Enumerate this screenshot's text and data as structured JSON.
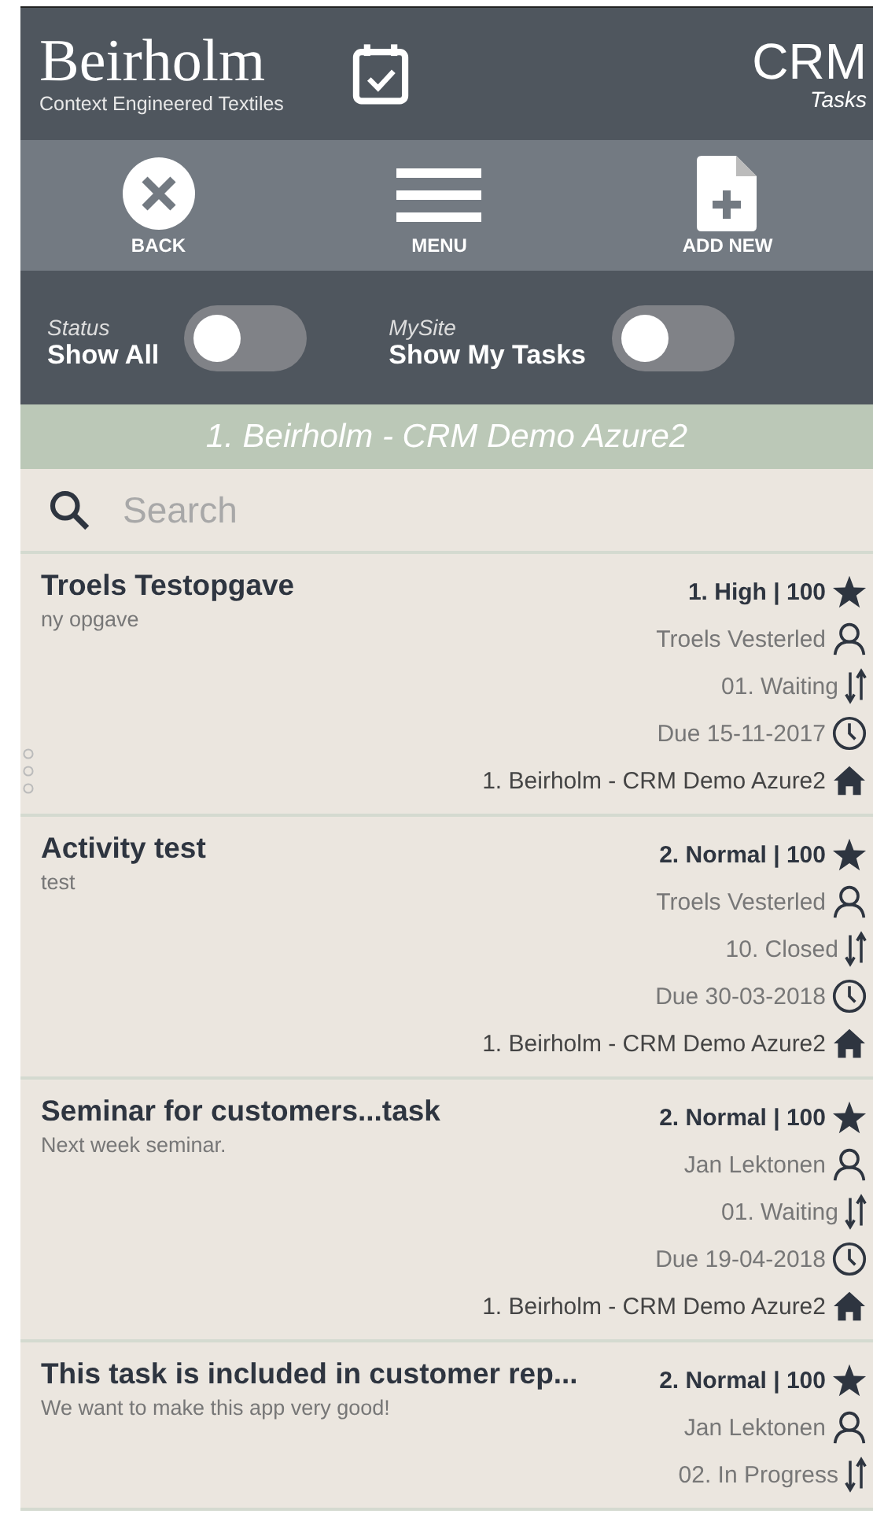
{
  "header": {
    "brand": "Beirholm",
    "tagline": "Context Engineered Textiles",
    "app": "CRM",
    "section": "Tasks"
  },
  "toolbar": [
    {
      "kind": "back",
      "label": "BACK"
    },
    {
      "kind": "menu",
      "label": "MENU"
    },
    {
      "kind": "add",
      "label": "ADD NEW"
    }
  ],
  "filters": [
    {
      "caption": "Status",
      "label": "Show All",
      "on": false
    },
    {
      "caption": "MySite",
      "label": "Show My Tasks",
      "on": false
    }
  ],
  "site_banner": "1. Beirholm - CRM Demo Azure2",
  "search": {
    "placeholder": "Search"
  },
  "tasks": [
    {
      "title": "Troels Testopgave",
      "description": "ny opgave",
      "priority": "1. High | 100",
      "owner": "Troels Vesterled",
      "status": "01. Waiting",
      "due": "Due 15-11-2017",
      "site": "1. Beirholm - CRM Demo Azure2",
      "drag_handle": true
    },
    {
      "title": "Activity test",
      "description": "test",
      "priority": "2. Normal | 100",
      "owner": "Troels Vesterled",
      "status": "10. Closed",
      "due": "Due 30-03-2018",
      "site": "1. Beirholm - CRM Demo Azure2",
      "drag_handle": false
    },
    {
      "title": "Seminar for customers...task",
      "description": "Next week seminar.",
      "priority": "2. Normal | 100",
      "owner": "Jan Lektonen",
      "status": "01. Waiting",
      "due": "Due 19-04-2018",
      "site": "1. Beirholm - CRM Demo Azure2",
      "drag_handle": false
    },
    {
      "title": "This task is included in customer rep...",
      "description": "We want to make this app very good!",
      "priority": "2. Normal | 100",
      "owner": "Jan Lektonen",
      "status": "02. In Progress",
      "drag_handle": false
    }
  ]
}
